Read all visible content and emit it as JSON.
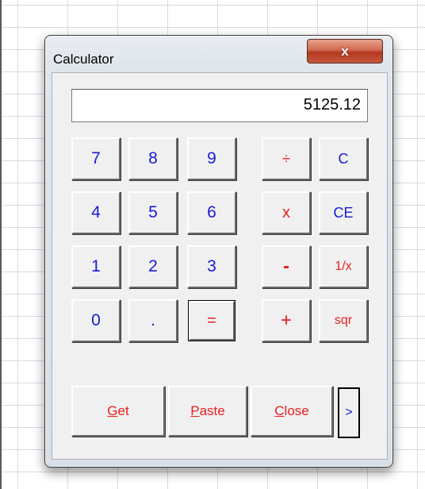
{
  "window": {
    "title": "Calculator",
    "close_label": "x"
  },
  "display": {
    "value": "5125.12"
  },
  "keys": {
    "seven": "7",
    "eight": "8",
    "nine": "9",
    "four": "4",
    "five": "5",
    "six": "6",
    "one": "1",
    "two": "2",
    "three": "3",
    "zero": "0",
    "dot": ".",
    "equals": "=",
    "divide": "÷",
    "multiply": "x",
    "subtract": "-",
    "add": "+",
    "clear": "C",
    "clear_entry": "CE",
    "reciprocal": "1/x",
    "sqrt": "sqr"
  },
  "actions": {
    "get": "Get",
    "paste": "Paste",
    "close": "Close",
    "more": ">"
  },
  "colors": {
    "digit": "#1a1ad6",
    "operator": "#e62020",
    "title_close": "#c7583d"
  }
}
